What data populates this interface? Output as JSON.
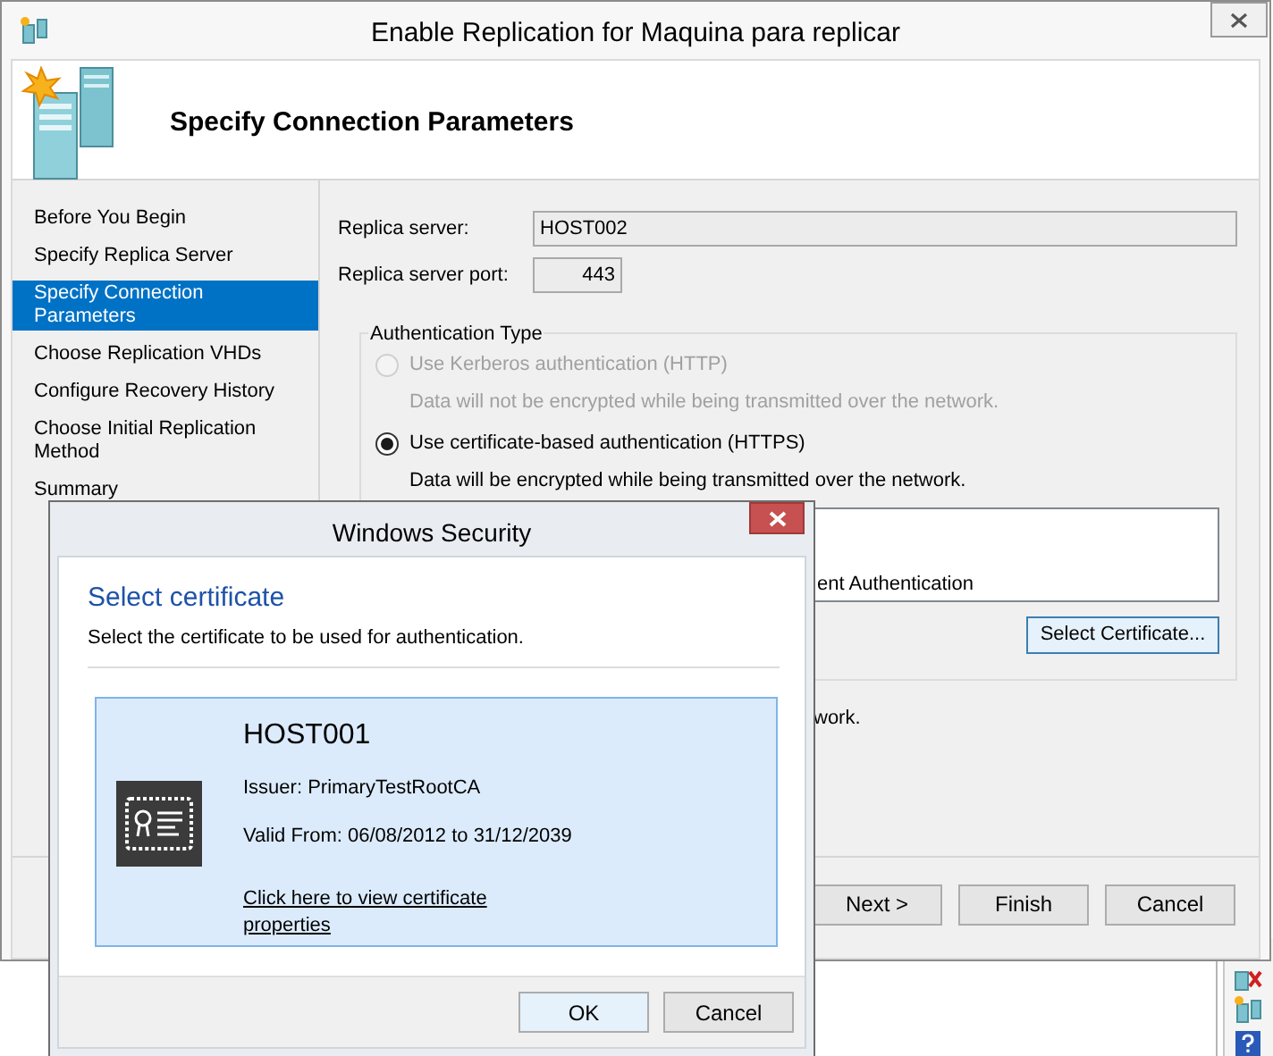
{
  "window": {
    "title": "Enable Replication for Maquina para replicar"
  },
  "header": {
    "title": "Specify Connection Parameters"
  },
  "nav": [
    {
      "label": "Before You Begin",
      "selected": false
    },
    {
      "label": "Specify Replica Server",
      "selected": false
    },
    {
      "label": "Specify Connection Parameters",
      "selected": true
    },
    {
      "label": "Choose Replication VHDs",
      "selected": false
    },
    {
      "label": "Configure Recovery History",
      "selected": false
    },
    {
      "label": "Choose Initial Replication Method",
      "selected": false
    },
    {
      "label": "Summary",
      "selected": false
    }
  ],
  "fields": [
    {
      "label": "Replica server:",
      "value": "HOST002",
      "kind": "wide"
    },
    {
      "label": "Replica server port:",
      "value": "443",
      "kind": "port"
    }
  ],
  "authentication": {
    "legend": "Authentication Type",
    "options": [
      {
        "label": "Use Kerberos authentication (HTTP)",
        "description": "Data will not be encrypted while being transmitted over the network.",
        "selected": false,
        "disabled": true
      },
      {
        "label": "Use certificate-based authentication (HTTPS)",
        "description": "Data will be encrypted while being transmitted over the network.",
        "selected": true,
        "disabled": false
      }
    ],
    "certificate_list_text": "ent Authentication",
    "select_button": "Select Certificate..."
  },
  "note": "work.",
  "buttons": [
    "Next >",
    "Finish",
    "Cancel"
  ],
  "dialog": {
    "title": "Windows Security",
    "heading": "Select certificate",
    "instruction": "Select the certificate to be used for authentication.",
    "certificate": {
      "name": "HOST001",
      "issuer": "Issuer: PrimaryTestRootCA",
      "valid": "Valid From: 06/08/2012 to 31/12/2039",
      "link": "Click here to view certificate properties",
      "selected": true
    },
    "buttons": [
      "OK",
      "Cancel"
    ]
  }
}
